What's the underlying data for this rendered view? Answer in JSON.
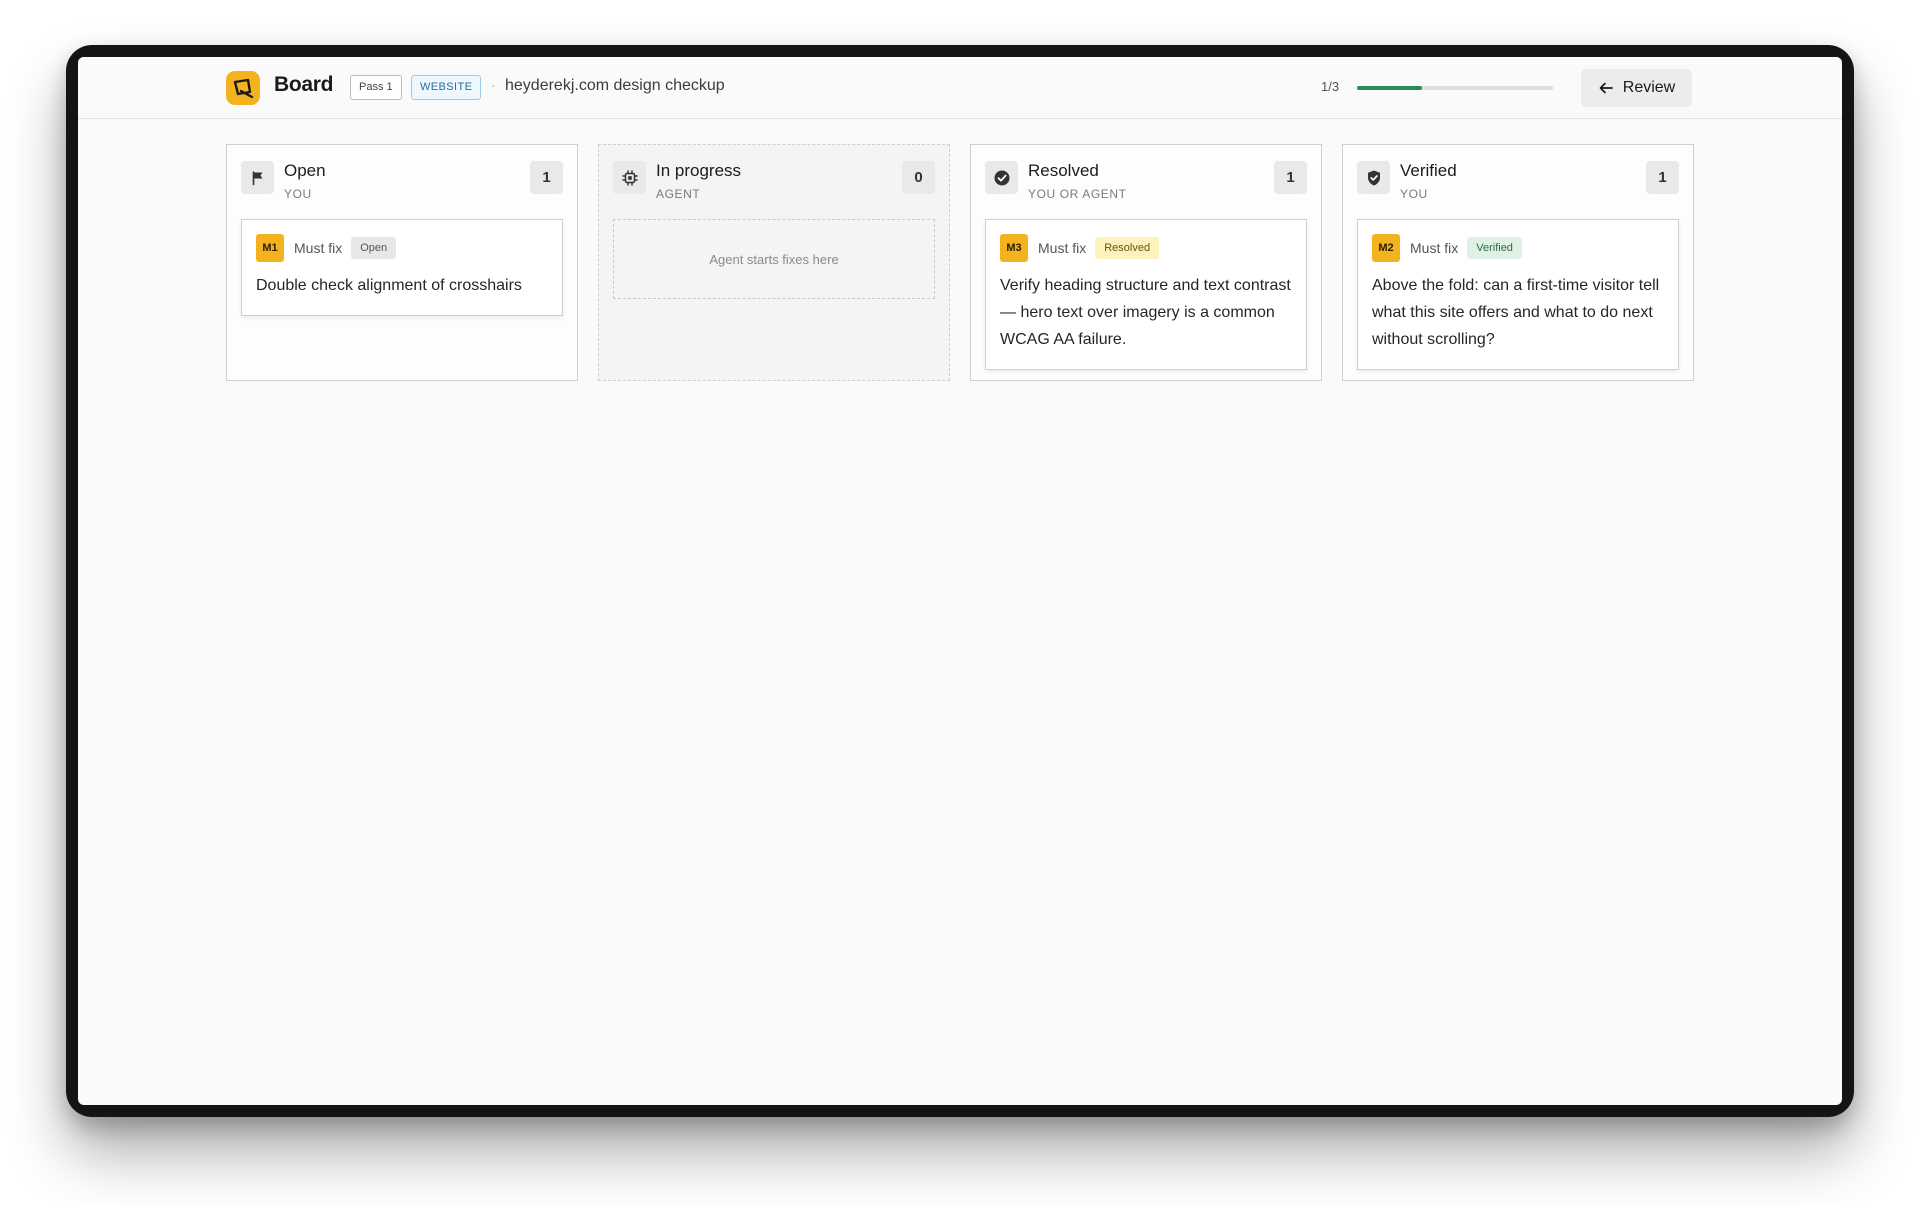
{
  "header": {
    "title": "Board",
    "pass_badge": "Pass 1",
    "type_badge": "WEBSITE",
    "separator": "·",
    "subtitle": "heyderekj.com design checkup",
    "progress_text": "1/3",
    "progress_fraction": 0.333,
    "review_label": "Review"
  },
  "columns": [
    {
      "title": "Open",
      "subtitle": "YOU",
      "count": "1",
      "icon": "flag-icon",
      "cards": [
        {
          "id": "M1",
          "priority": "Must fix",
          "status": "Open",
          "text": "Double check alignment of crosshairs"
        }
      ]
    },
    {
      "title": "In progress",
      "subtitle": "AGENT",
      "count": "0",
      "icon": "chip-icon",
      "empty_text": "Agent starts fixes here"
    },
    {
      "title": "Resolved",
      "subtitle": "YOU OR AGENT",
      "count": "1",
      "icon": "check-circle-icon",
      "cards": [
        {
          "id": "M3",
          "priority": "Must fix",
          "status": "Resolved",
          "text": "Verify heading structure and text contrast — hero text over imagery is a common WCAG AA failure."
        }
      ]
    },
    {
      "title": "Verified",
      "subtitle": "YOU",
      "count": "1",
      "icon": "shield-check-icon",
      "cards": [
        {
          "id": "M2",
          "priority": "Must fix",
          "status": "Verified",
          "text": "Above the fold: can a first-time visitor tell what this site offers and what to do next without scrolling?"
        }
      ]
    }
  ],
  "colors": {
    "accent": "#f5b21f",
    "progress": "#2a8a5e",
    "resolved_bg": "#fdf1bd",
    "verified_bg": "#def1e4"
  }
}
